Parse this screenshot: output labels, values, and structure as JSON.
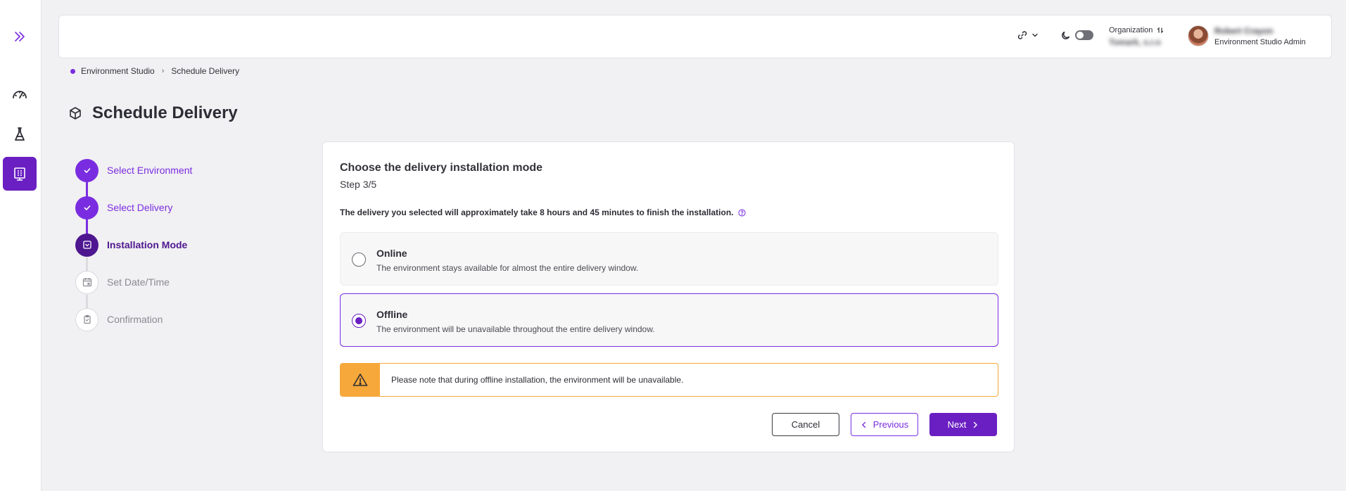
{
  "header": {
    "link_icon": "link-icon",
    "theme_icon": "moon-icon",
    "organization_label": "Organization",
    "organization_value": "Tomark, s.r.o",
    "user_name": "Robert Crayon",
    "user_role": "Environment Studio Admin"
  },
  "rail": {
    "items": [
      {
        "name": "expand",
        "icon": "double-chevron-right-icon"
      },
      {
        "name": "dashboard",
        "icon": "gauge-icon"
      },
      {
        "name": "deliveries",
        "icon": "flask-icon"
      },
      {
        "name": "environment-studio",
        "icon": "building-icon",
        "active": true
      }
    ]
  },
  "breadcrumb": {
    "items": [
      "Environment Studio",
      "Schedule Delivery"
    ]
  },
  "page": {
    "title": "Schedule Delivery"
  },
  "stepper": {
    "steps": [
      {
        "label": "Select Environment",
        "state": "done"
      },
      {
        "label": "Select Delivery",
        "state": "done"
      },
      {
        "label": "Installation Mode",
        "state": "current"
      },
      {
        "label": "Set Date/Time",
        "state": "pending"
      },
      {
        "label": "Confirmation",
        "state": "pending"
      }
    ]
  },
  "card": {
    "title": "Choose the delivery installation mode",
    "step_text": "Step 3/5",
    "info_text": "The delivery you selected will approximately take 8 hours and 45 minutes to finish the installation.",
    "options": [
      {
        "title": "Online",
        "description": "The environment stays available for almost the entire delivery window.",
        "selected": false
      },
      {
        "title": "Offline",
        "description": "The environment will be unavailable throughout the entire delivery window.",
        "selected": true
      }
    ],
    "warning_text": "Please note that during offline installation, the environment will be unavailable.",
    "buttons": {
      "cancel": "Cancel",
      "previous": "Previous",
      "next": "Next"
    }
  },
  "colors": {
    "accent": "#7a2de0",
    "accent_dark": "#4e1790",
    "warning": "#f7a83a"
  }
}
